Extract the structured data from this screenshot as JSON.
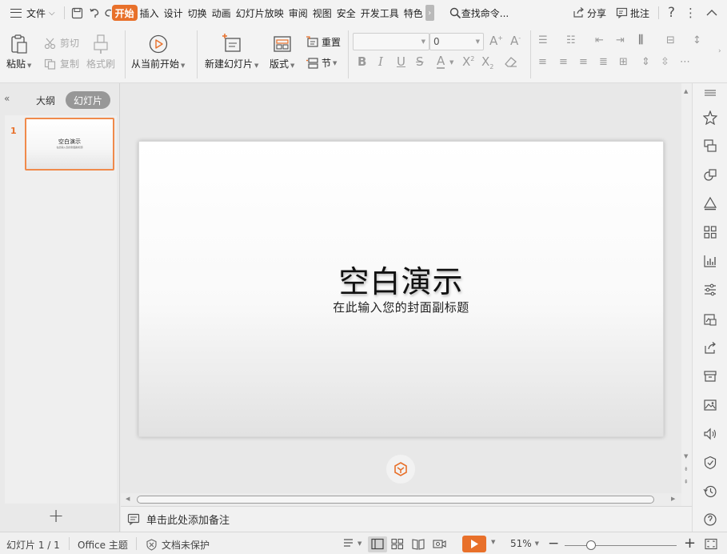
{
  "menubar": {
    "file": "文件",
    "tabs": [
      "开始",
      "插入",
      "设计",
      "切换",
      "动画",
      "幻灯片放映",
      "审阅",
      "视图",
      "安全",
      "开发工具",
      "特色"
    ],
    "search": "查找命令...",
    "share": "分享",
    "comment": "批注",
    "help": "?"
  },
  "ribbon": {
    "paste": "粘贴",
    "cut": "剪切",
    "copy": "复制",
    "format_painter": "格式刷",
    "play_from_current": "从当前开始",
    "new_slide": "新建幻灯片",
    "layout": "版式",
    "reset": "重置",
    "section": "节",
    "font_size": "0",
    "font_name": ""
  },
  "leftpanel": {
    "outline_tab": "大纲",
    "slides_tab": "幻灯片",
    "slide_number": "1",
    "thumb_title": "空白演示",
    "thumb_subtitle": "在此输入您的封面副标题"
  },
  "slide": {
    "title": "空白演示",
    "subtitle": "在此输入您的封面副标题"
  },
  "notes": {
    "placeholder": "单击此处添加备注"
  },
  "statusbar": {
    "slide_count": "幻灯片 1 / 1",
    "theme": "Office 主题",
    "protection": "文档未保护",
    "zoom": "51%"
  },
  "colors": {
    "accent": "#e8702a",
    "thumb_border": "#f08a4b"
  }
}
